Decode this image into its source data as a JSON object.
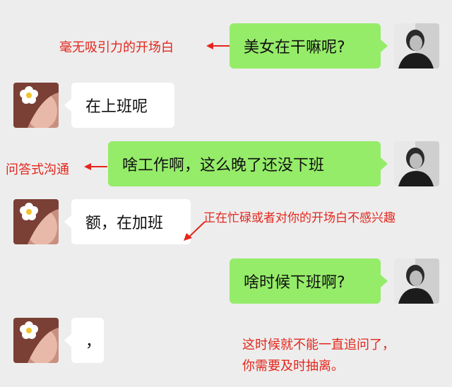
{
  "messages": [
    {
      "side": "right",
      "text": "美女在干嘛呢?"
    },
    {
      "side": "left",
      "text": "在上班呢"
    },
    {
      "side": "right",
      "text": "啥工作啊，这么晚了还没下班"
    },
    {
      "side": "left",
      "text": "额，在加班"
    },
    {
      "side": "right",
      "text": "啥时候下班啊?"
    },
    {
      "side": "left",
      "text": "，"
    }
  ],
  "annotations": {
    "a1": "毫无吸引力的开场白",
    "a2": "问答式沟通",
    "a3": "正在忙碌或者对你的开场白不感兴趣",
    "a4_line1": "这时候就不能一直追问了，",
    "a4_line2": "你需要及时抽离。"
  },
  "colors": {
    "background": "#ededed",
    "sent_bubble": "#95ec69",
    "received_bubble": "#ffffff",
    "annotation": "#e4261c"
  },
  "icons": {
    "sent_avatar": "man-portrait-avatar",
    "received_avatar": "girl-flower-avatar"
  }
}
